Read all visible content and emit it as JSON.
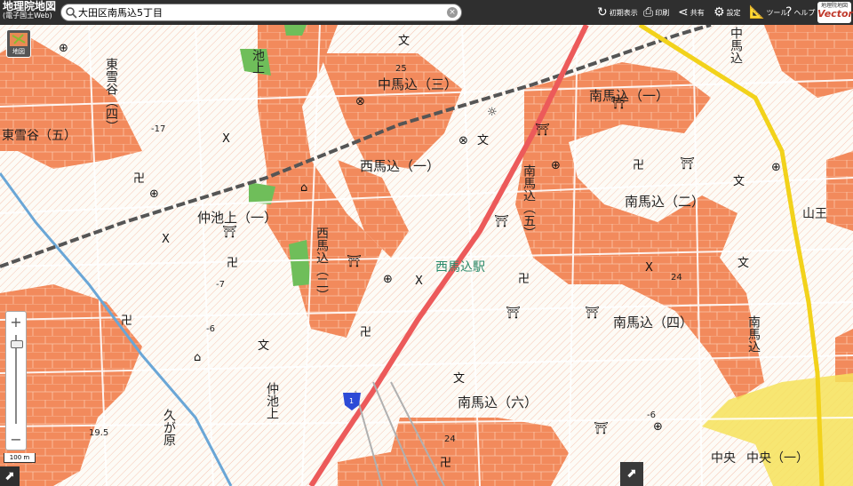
{
  "header": {
    "logo_title": "地理院地図",
    "logo_sub": "(電子国土Web)",
    "search_value": "大田区南馬込5丁目",
    "buttons": [
      {
        "icon": "reset-icon",
        "glyph": "↻",
        "label": "初期表示"
      },
      {
        "icon": "print-icon",
        "glyph": "⎙",
        "label": "印刷"
      },
      {
        "icon": "share-icon",
        "glyph": "⋖",
        "label": "共有"
      },
      {
        "icon": "settings-icon",
        "glyph": "⚙",
        "label": "設定"
      },
      {
        "icon": "tools-icon",
        "glyph": "📐",
        "label": "ツール"
      },
      {
        "icon": "help-icon",
        "glyph": "?",
        "label": "ヘルプ"
      }
    ],
    "vector_top": "地理院地図",
    "vector_label": "Vector"
  },
  "controls": {
    "layer_label": "地図",
    "zoom_in": "+",
    "zoom_out": "−",
    "scale_label": "100 m"
  },
  "map": {
    "colors": {
      "land": "#fdfbf6",
      "hazard": "#f28a5c",
      "hazard_dark": "#ee7a48",
      "road": "#ffffff",
      "rail": "#555555",
      "main_road": "#ec5a5a",
      "yellow_road": "#f2d21b",
      "yellow_zone": "#f6e25a",
      "water_line": "#6aa6d6",
      "park": "#6fbe5a",
      "station_text": "#2a8a6a"
    },
    "area_labels": [
      "中馬込（三）",
      "南馬込（一）",
      "西馬込（一）",
      "南馬込（二）",
      "南馬込（四）",
      "南馬込（六）",
      "仲池上（一）",
      "東雪谷（五）",
      "中央",
      "中央（一）"
    ],
    "vertical_labels": [
      "東雪谷（四）",
      "池上",
      "西馬込（二）",
      "南馬込（五）",
      "仲池上",
      "久が原",
      "南馬込",
      "中馬込",
      "山王"
    ],
    "station_label": "西馬込駅",
    "elevations": [
      "25",
      "-17",
      "24",
      "-7",
      "-6",
      "19.5",
      "-6",
      "24"
    ],
    "route_number": "1"
  }
}
